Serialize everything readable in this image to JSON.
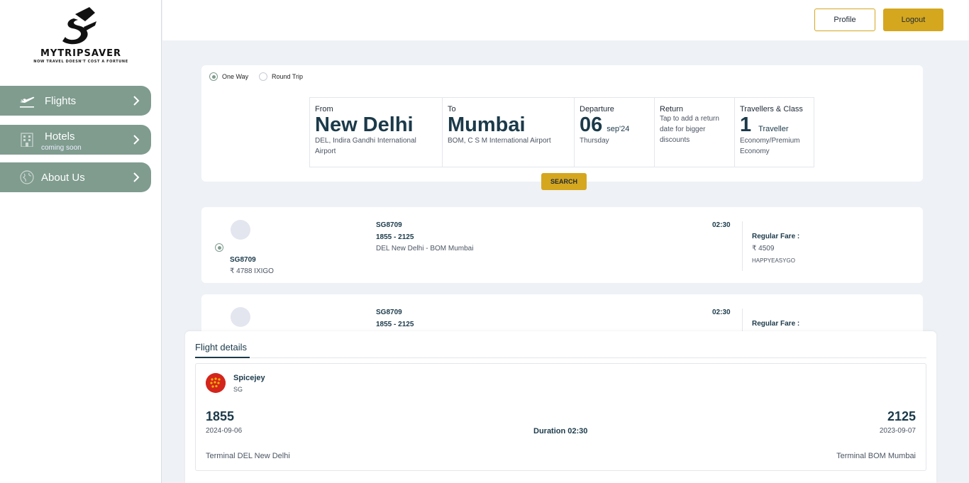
{
  "brand": {
    "name": "MYTRIPSAVER",
    "tagline": "NOW TRAVEL DOESN'T COST A FORTUNE",
    "accent_color": "#d5a71f",
    "nav_color": "#7f9c8f"
  },
  "header": {
    "profile_label": "Profile",
    "logout_label": "Logout"
  },
  "sidebar": {
    "items": [
      {
        "label": "Flights",
        "icon": "airplane-icon"
      },
      {
        "label": "Hotels",
        "sub": "coming soon",
        "icon": "building-icon"
      },
      {
        "label": "About Us",
        "icon": "globe-icon"
      }
    ]
  },
  "search": {
    "trip_types": [
      {
        "label": "One Way",
        "selected": true
      },
      {
        "label": "Round Trip",
        "selected": false
      }
    ],
    "from": {
      "label": "From",
      "city": "New Delhi",
      "airport": "DEL, Indira Gandhi International Airport"
    },
    "to": {
      "label": "To",
      "city": "Mumbai",
      "airport": "BOM, C S M International Airport"
    },
    "departure": {
      "label": "Departure",
      "day": "06",
      "month_year": "sep'24",
      "weekday": "Thursday"
    },
    "return": {
      "label": "Return",
      "hint": "Tap to add a return date for bigger discounts"
    },
    "travellers": {
      "label": "Travellers & Class",
      "count": "1",
      "unit": "Traveller",
      "class": "Economy/Premium Economy"
    },
    "button_label": "SEARCH"
  },
  "results": [
    {
      "selected": true,
      "code_left": "SG8709",
      "price_left": "₹ 4788 IXIGO",
      "code": "SG8709",
      "times": "1855 - 2125",
      "route": "DEL New Delhi - BOM Mumbai",
      "duration": "02:30",
      "fare_label": "Regular Fare :",
      "fare": "₹ 4509",
      "coupon": "HAPPYEASYGO"
    },
    {
      "selected": false,
      "code": "SG8709",
      "times": "1855 - 2125",
      "duration": "02:30",
      "fare_label": "Regular Fare :"
    }
  ],
  "details": {
    "tab_label": "Flight details",
    "airline_name": "Spicejey",
    "airline_code": "SG",
    "departure_time": "1855",
    "departure_date": "2024-09-06",
    "duration": "Duration 02:30",
    "arrival_time": "2125",
    "arrival_date": "2023-09-07",
    "departure_terminal": "Terminal DEL New Delhi",
    "arrival_terminal": "Terminal BOM Mumbai"
  }
}
